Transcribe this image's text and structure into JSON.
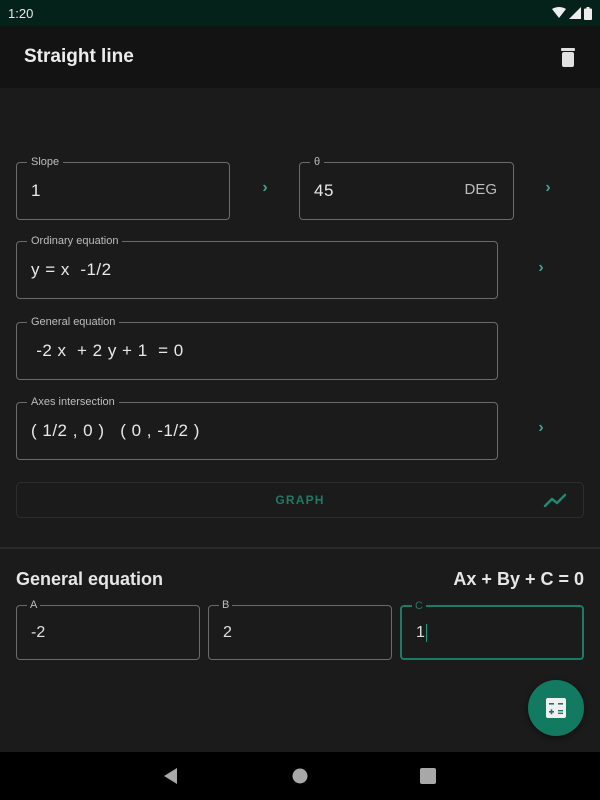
{
  "status_bar": {
    "time": "1:20",
    "icons": [
      "wifi-icon",
      "signal-icon",
      "battery-icon"
    ]
  },
  "app_bar": {
    "title": "Straight line",
    "action_icon": "trash-icon"
  },
  "fields": {
    "slope": {
      "label": "Slope",
      "value": "1"
    },
    "theta": {
      "label": "θ",
      "value": "45",
      "unit": "DEG"
    },
    "ordinary": {
      "label": "Ordinary equation",
      "value": "y = x  -1/2"
    },
    "general": {
      "label": "General equation",
      "value": " -2 x  + 2 y + 1  = 0"
    },
    "axes": {
      "label": "Axes intersection",
      "value": "( 1/2 , 0 )   ( 0 , -1/2 )"
    }
  },
  "graph_button": {
    "label": "GRAPH",
    "icon": "line-chart-icon"
  },
  "general_section": {
    "title": "General equation",
    "formula": "Ax + By + C = 0",
    "coefficients": [
      {
        "label": "A",
        "value": "-2"
      },
      {
        "label": "B",
        "value": "2"
      },
      {
        "label": "C",
        "value": "1",
        "focused": true
      }
    ]
  },
  "fab": {
    "icon": "calculator-icon"
  },
  "nav": {
    "back": "back-icon",
    "home": "home-icon",
    "recents": "recents-icon"
  },
  "colors": {
    "accent": "#137a62",
    "accent_text": "#1f7a63",
    "chevron": "#3fa38c",
    "background": "#1b1b1b",
    "status_bar": "#04211a"
  }
}
